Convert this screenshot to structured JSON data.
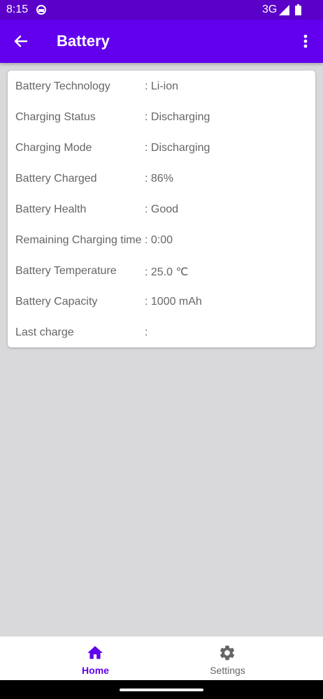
{
  "status_bar": {
    "time": "8:15",
    "network": "3G"
  },
  "app_bar": {
    "title": "Battery"
  },
  "battery_info": [
    {
      "label": "Battery Technology",
      "value": ": Li-ion"
    },
    {
      "label": "Charging Status",
      "value": ": Discharging"
    },
    {
      "label": "Charging Mode",
      "value": ": Discharging"
    },
    {
      "label": "Battery Charged",
      "value": ": 86%"
    },
    {
      "label": "Battery Health",
      "value": ": Good"
    },
    {
      "label": "Remaining Charging time",
      "value": ": 0:00"
    },
    {
      "label": "Battery Temperature",
      "value": ": 25.0 ℃"
    },
    {
      "label": "Battery Capacity",
      "value": ": 1000 mAh"
    },
    {
      "label": "Last charge",
      "value": ":"
    }
  ],
  "bottom_nav": {
    "items": [
      {
        "label": "Home",
        "icon": "home-icon",
        "active": true
      },
      {
        "label": "Settings",
        "icon": "gear-icon",
        "active": false
      }
    ]
  },
  "colors": {
    "primary": "#6200ee",
    "primary_dark": "#5a00c9",
    "background": "#d9d9db",
    "text_secondary": "#666666"
  }
}
